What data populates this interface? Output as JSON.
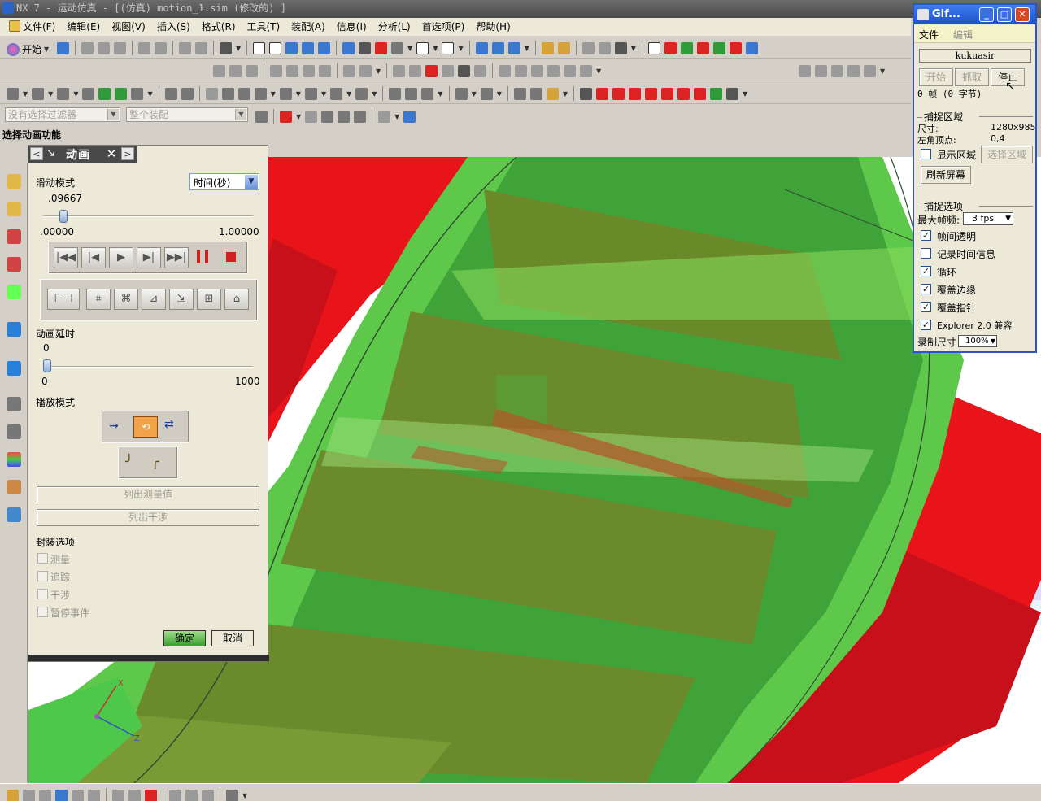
{
  "window": {
    "title": "NX 7 - 运动仿真 - [(仿真) motion_1.sim  (修改的) ]"
  },
  "menu": {
    "items": [
      "文件(F)",
      "编辑(E)",
      "视图(V)",
      "插入(S)",
      "格式(R)",
      "工具(T)",
      "装配(A)",
      "信息(I)",
      "分析(L)",
      "首选项(P)",
      "帮助(H)"
    ]
  },
  "toolbar": {
    "start_label": "开始"
  },
  "filter": {
    "selection_filter": "没有选择过滤器",
    "assembly_scope": "整个装配"
  },
  "cue": {
    "text": "选择动画功能"
  },
  "dialog": {
    "title": "动画",
    "slide_mode_label": "滑动模式",
    "slide_mode_value": "时间(秒)",
    "current_value": ".09667",
    "slider_min": ".00000",
    "slider_max": "1.00000",
    "slider_fraction": 0.09667,
    "delay_label": "动画延时",
    "delay_value": "0",
    "delay_min": "0",
    "delay_max": "1000",
    "delay_fraction": 0,
    "play_mode_label": "播放模式",
    "list_measure_label": "列出测量值",
    "list_interference_label": "列出干涉",
    "package_options_label": "封装选项",
    "options": [
      "测量",
      "追踪",
      "干涉",
      "暂停事件"
    ],
    "ok_label": "确定",
    "cancel_label": "取消"
  },
  "gif_window": {
    "title": "Gif...",
    "menu": [
      "文件",
      "编辑"
    ],
    "user": "kukuasir",
    "btn_start": "开始",
    "btn_capture": "抓取",
    "btn_stop": "停止",
    "frames_status": "0 帧 (0 字节)",
    "capture_area_label": "捕捉区域",
    "size_label": "尺寸:",
    "size_value": "1280x985",
    "corner_label": "左角顶点:",
    "corner_value": "0,4",
    "show_area_label": "显示区域",
    "select_area_label": "选择区域",
    "refresh_label": "刷新屏幕",
    "capture_options_label": "捕捉选项",
    "max_fps_label": "最大帧频:",
    "max_fps_value": "3 fps",
    "options": [
      {
        "label": "帧间透明",
        "checked": true
      },
      {
        "label": "记录时间信息",
        "checked": false
      },
      {
        "label": "循环",
        "checked": true
      },
      {
        "label": "覆盖边缘",
        "checked": true
      },
      {
        "label": "覆盖指针",
        "checked": true
      },
      {
        "label": "Explorer 2.0 兼容",
        "checked": true
      }
    ],
    "record_size_label": "录制尺寸",
    "record_size_value": "100%"
  },
  "colors": {
    "gear_red": "#e8141a",
    "body_green": "#5ec84a",
    "panel": "#ece9d8",
    "xp_blue": "#2b55c7"
  }
}
